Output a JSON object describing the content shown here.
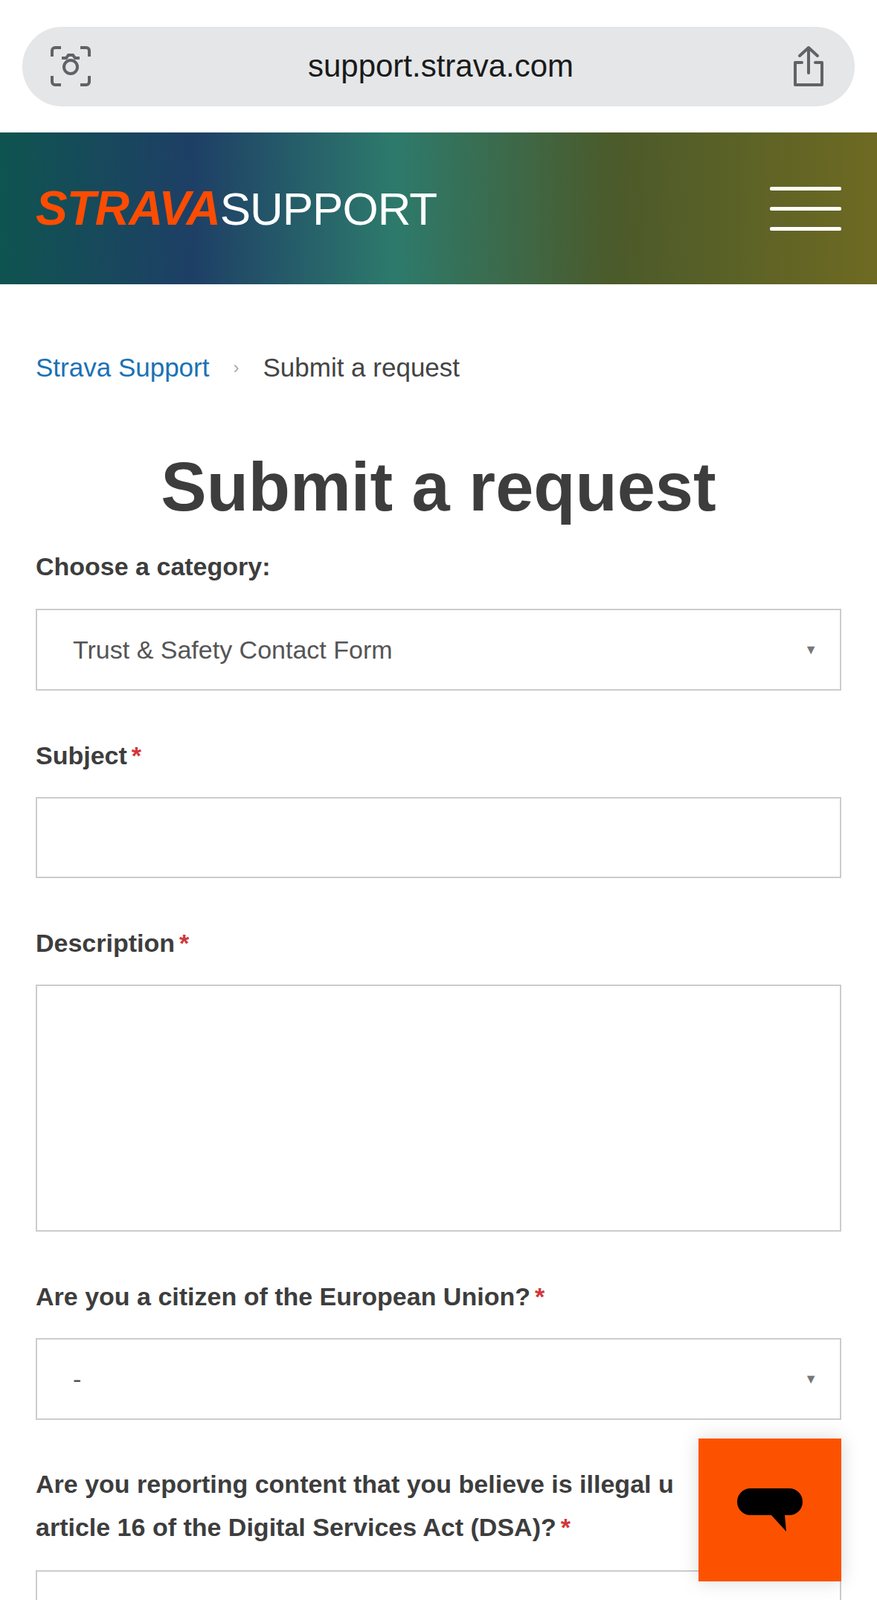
{
  "browser": {
    "url": "support.strava.com"
  },
  "header": {
    "logo_brand": "STRAVA",
    "logo_product": "SUPPORT"
  },
  "breadcrumb": {
    "separator": "›",
    "items": [
      {
        "label": "Strava Support",
        "link": true
      },
      {
        "label": "Submit a request",
        "link": false
      }
    ]
  },
  "page_title": "Submit a request",
  "category": {
    "label": "Choose a category:",
    "value": "Trust & Safety Contact Form",
    "arrow": "▼"
  },
  "fields": [
    {
      "kind": "input",
      "label_lines": [
        "Subject"
      ],
      "required_mark": "*",
      "value": "",
      "arrow": ""
    },
    {
      "kind": "textarea",
      "label_lines": [
        "Description"
      ],
      "required_mark": "*",
      "value": "",
      "arrow": ""
    },
    {
      "kind": "select",
      "label_lines": [
        "Are you a citizen of the European Union?"
      ],
      "required_mark": "*",
      "value": "-",
      "arrow": "▼"
    },
    {
      "kind": "input",
      "label_lines": [
        "Are you reporting content that you believe is illegal u",
        "article 16 of the Digital Services Act (DSA)?"
      ],
      "required_mark": "*",
      "value": "",
      "arrow": ""
    }
  ]
}
